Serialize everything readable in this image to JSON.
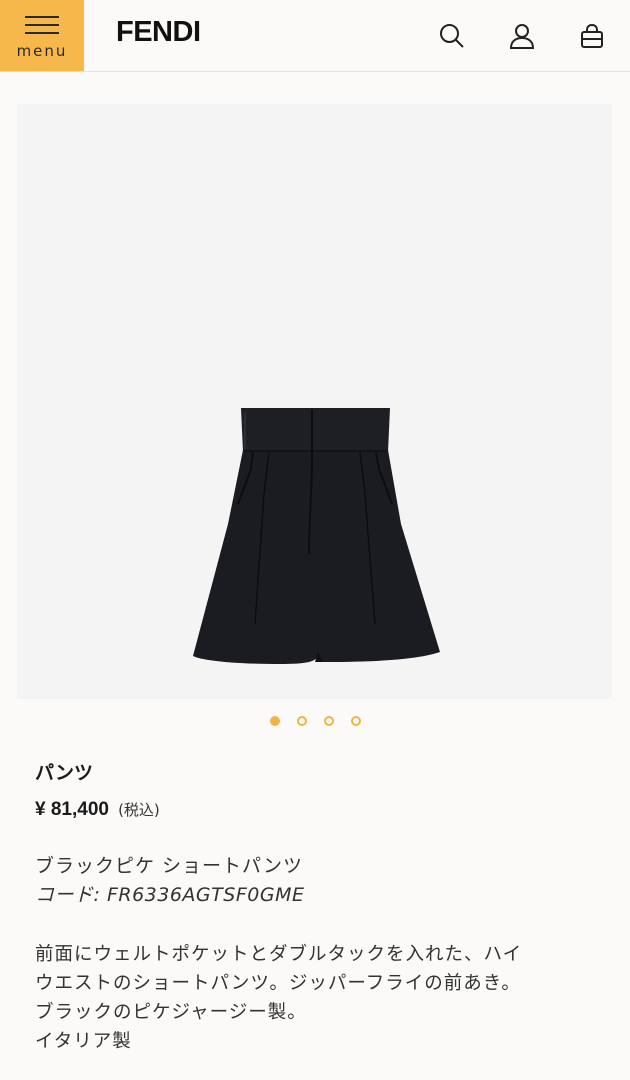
{
  "header": {
    "menu_label": "menu",
    "logo": "FENDI",
    "icons": [
      "search-icon",
      "account-icon",
      "bag-icon"
    ],
    "menu_color": "#f6b84b"
  },
  "gallery": {
    "image": "black-high-waist-pleated-shorts",
    "image_count": 4,
    "active_index": 0,
    "accent_color": "#f0b547"
  },
  "product": {
    "name": "パンツ",
    "price": "¥ 81,400",
    "tax_note": "(税込)",
    "subtitle": "ブラックピケ ショートパンツ",
    "code_label": "コード:",
    "code_value": "FR6336AGTSF0GME",
    "description_lines": [
      "前面にウェルトポケットとダブルタックを入れた、ハイ",
      "ウエストのショートパンツ。ジッパーフライの前あき。",
      "ブラックのピケジャージー製。",
      "イタリア製"
    ]
  }
}
